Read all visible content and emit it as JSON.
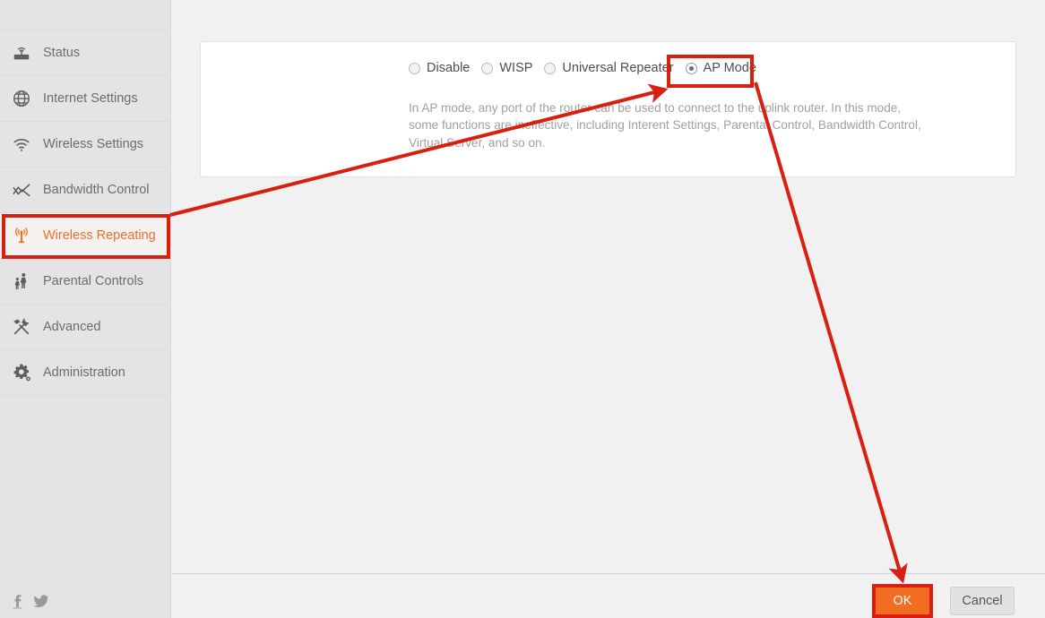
{
  "sidebar": {
    "items": [
      {
        "label": "Status",
        "icon": "router-icon",
        "active": false
      },
      {
        "label": "Internet Settings",
        "icon": "globe-icon",
        "active": false
      },
      {
        "label": "Wireless Settings",
        "icon": "wifi-icon",
        "active": false
      },
      {
        "label": "Bandwidth Control",
        "icon": "chart-icon",
        "active": false
      },
      {
        "label": "Wireless Repeating",
        "icon": "antenna-icon",
        "active": true
      },
      {
        "label": "Parental Controls",
        "icon": "family-icon",
        "active": false
      },
      {
        "label": "Advanced",
        "icon": "tools-icon",
        "active": false
      },
      {
        "label": "Administration",
        "icon": "gear-icon",
        "active": false
      }
    ],
    "social": [
      {
        "name": "facebook-icon",
        "glyph": "f"
      },
      {
        "name": "twitter-icon",
        "glyph": "t"
      }
    ]
  },
  "main": {
    "modes": [
      {
        "label": "Disable",
        "selected": false
      },
      {
        "label": "WISP",
        "selected": false
      },
      {
        "label": "Universal Repeater",
        "selected": false
      },
      {
        "label": "AP Mode",
        "selected": true
      }
    ],
    "description": "In AP mode, any port of the router can be used to connect to the uplink router. In this mode, some functions are ineffective, including Interent Settings, Parental Control, Bandwidth Control, Virtual Server, and so on.",
    "buttons": {
      "ok": "OK",
      "cancel": "Cancel"
    }
  },
  "annotations": {
    "highlight_color": "#d91f11",
    "boxes": [
      "sidebar-wireless-repeating",
      "ap-mode-radio",
      "ok-button"
    ],
    "arrows": [
      {
        "from": "sidebar-wireless-repeating",
        "to": "ap-mode-radio"
      },
      {
        "from": "ap-mode-radio",
        "to": "ok-button"
      }
    ]
  },
  "colors": {
    "accent": "#f26d21",
    "sidebar_bg": "#e4e4e4",
    "main_bg": "#f1f1f1",
    "card_bg": "#ffffff",
    "text": "#6c6c6c",
    "muted_text": "#a0a0a0",
    "annotation": "#d91f11"
  }
}
